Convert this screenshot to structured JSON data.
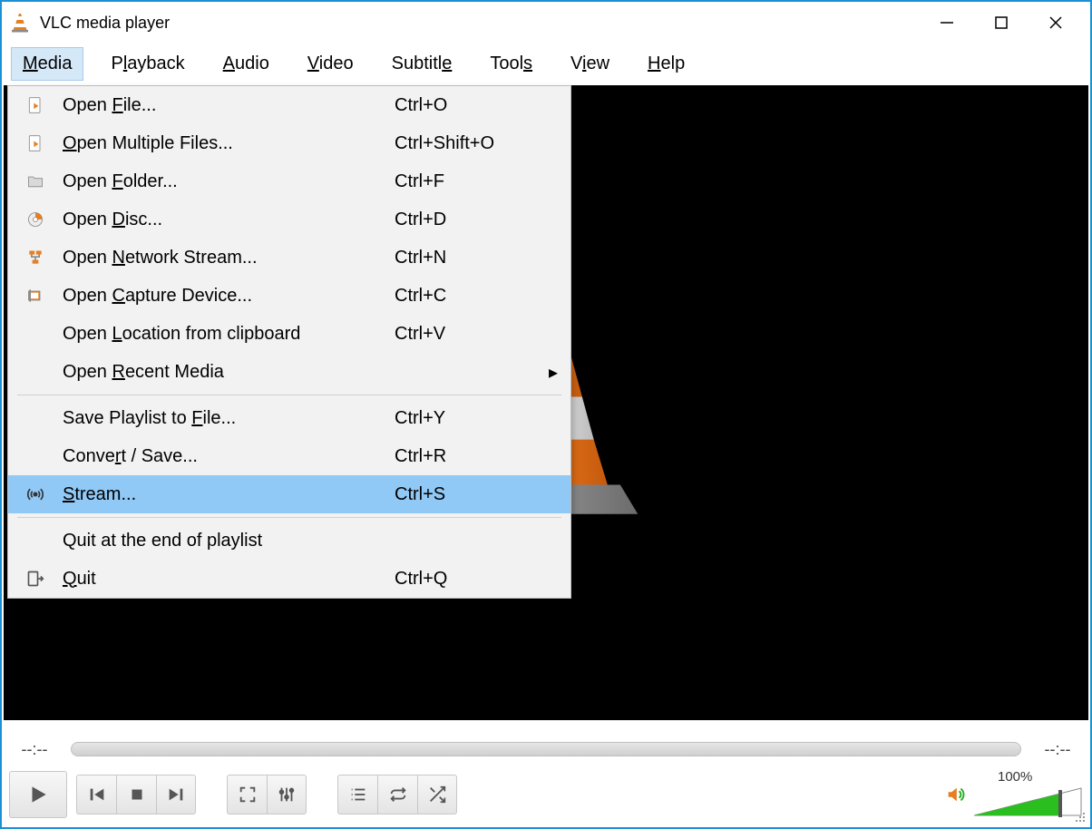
{
  "app": {
    "title": "VLC media player"
  },
  "menubar": [
    "Media",
    "Playback",
    "Audio",
    "Video",
    "Subtitle",
    "Tools",
    "View",
    "Help"
  ],
  "menubar_hotkeys": [
    "M",
    "l",
    "A",
    "V",
    "e",
    "s",
    "i",
    "H"
  ],
  "menubar_active": 0,
  "dropdown": {
    "highlight_index": 10,
    "sections": [
      [
        {
          "icon": "file-play-icon",
          "label": "Open File...",
          "hot": "F",
          "shortcut": "Ctrl+O"
        },
        {
          "icon": "file-play-icon",
          "label": "Open Multiple Files...",
          "hot": "O",
          "shortcut": "Ctrl+Shift+O"
        },
        {
          "icon": "folder-icon",
          "label": "Open Folder...",
          "hot": "F",
          "shortcut": "Ctrl+F"
        },
        {
          "icon": "disc-icon",
          "label": "Open Disc...",
          "hot": "D",
          "shortcut": "Ctrl+D"
        },
        {
          "icon": "network-icon",
          "label": "Open Network Stream...",
          "hot": "N",
          "shortcut": "Ctrl+N"
        },
        {
          "icon": "capture-icon",
          "label": "Open Capture Device...",
          "hot": "C",
          "shortcut": "Ctrl+C"
        },
        {
          "icon": "",
          "label": "Open Location from clipboard",
          "hot": "L",
          "shortcut": "Ctrl+V"
        },
        {
          "icon": "",
          "label": "Open Recent Media",
          "hot": "R",
          "shortcut": "",
          "submenu": true
        }
      ],
      [
        {
          "icon": "",
          "label": "Save Playlist to File...",
          "hot": "F",
          "shortcut": "Ctrl+Y"
        },
        {
          "icon": "",
          "label": "Convert / Save...",
          "hot": "r",
          "shortcut": "Ctrl+R"
        },
        {
          "icon": "stream-icon",
          "label": "Stream...",
          "hot": "S",
          "shortcut": "Ctrl+S"
        }
      ],
      [
        {
          "icon": "",
          "label": "Quit at the end of playlist",
          "hot": "",
          "shortcut": ""
        },
        {
          "icon": "quit-icon",
          "label": "Quit",
          "hot": "Q",
          "shortcut": "Ctrl+Q"
        }
      ]
    ]
  },
  "time": {
    "elapsed": "--:--",
    "remaining": "--:--"
  },
  "volume": {
    "label": "100%",
    "value": 100
  }
}
